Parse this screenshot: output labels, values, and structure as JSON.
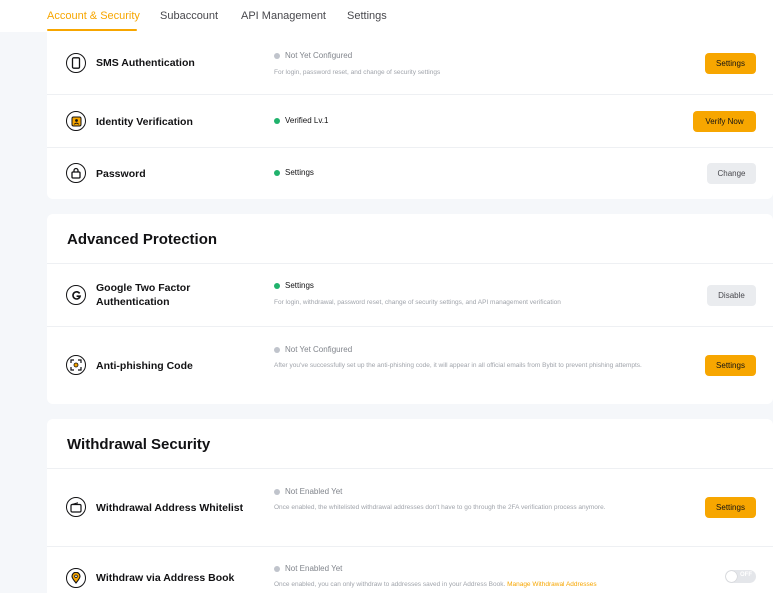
{
  "tabs": [
    {
      "label": "Account & Security",
      "active": true
    },
    {
      "label": "Subaccount",
      "active": false
    },
    {
      "label": "API Management",
      "active": false
    },
    {
      "label": "Settings",
      "active": false
    }
  ],
  "basic": {
    "sms": {
      "icon": "phone-icon",
      "label": "SMS Authentication",
      "status": "Not Yet Configured",
      "description": "For login, password reset, and change of security settings",
      "button": "Settings"
    },
    "identity": {
      "icon": "id-card-icon",
      "label": "Identity Verification",
      "status": "Verified Lv.1",
      "button": "Verify Now"
    },
    "password": {
      "icon": "lock-icon",
      "label": "Password",
      "status": "Settings",
      "button": "Change"
    }
  },
  "advanced": {
    "title": "Advanced Protection",
    "google": {
      "icon": "google-icon",
      "label": "Google Two Factor Authentication",
      "status": "Settings",
      "description": "For login, withdrawal, password reset, change of security settings, and API management verification",
      "button": "Disable"
    },
    "antiphishing": {
      "icon": "anti-phishing-icon",
      "label": "Anti-phishing Code",
      "status": "Not Yet Configured",
      "description": "After you've successfully set up the anti-phishing code, it will appear in all official emails from Bybit to prevent phishing attempts.",
      "button": "Settings"
    }
  },
  "withdrawal": {
    "title": "Withdrawal Security",
    "whitelist": {
      "icon": "wallet-icon",
      "label": "Withdrawal Address Whitelist",
      "status": "Not Enabled Yet",
      "description": "Once enabled, the whitelisted withdrawal addresses don't have to go through the 2FA verification process anymore.",
      "button": "Settings"
    },
    "addressbook": {
      "icon": "location-pin-icon",
      "label": "Withdraw via Address Book",
      "status": "Not Enabled Yet",
      "description": "Once enabled, you can only withdraw to addresses saved in your Address Book.",
      "link": "Manage Withdrawal Addresses",
      "toggle_label": "OFF",
      "toggle_on": false
    }
  },
  "colors": {
    "accent": "#f7a600",
    "success": "#20b26c",
    "muted": "#81858c",
    "background": "#f5f7fa"
  }
}
